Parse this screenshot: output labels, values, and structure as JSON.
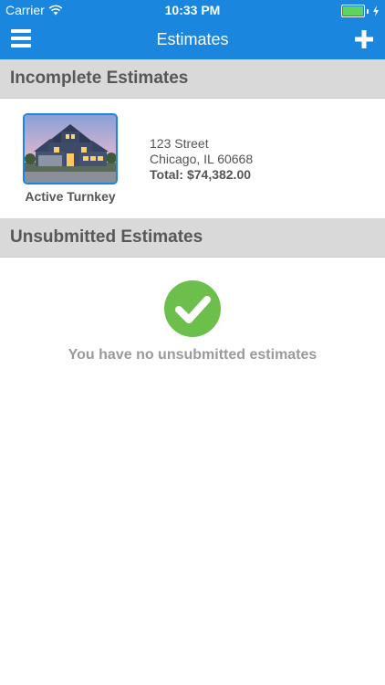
{
  "status_bar": {
    "carrier": "Carrier",
    "time": "10:33 PM"
  },
  "nav": {
    "title": "Estimates",
    "menu_icon": "hamburger-menu-icon",
    "add_icon": "plus-icon"
  },
  "sections": {
    "incomplete": {
      "title": "Incomplete Estimates",
      "items": [
        {
          "name": "Active Turnkey",
          "street": "123 Street",
          "city": "Chicago, IL 60668",
          "total": "Total: $74,382.00"
        }
      ]
    },
    "unsubmitted": {
      "title": "Unsubmitted Estimates",
      "empty_message": "You have no unsubmitted estimates",
      "empty_icon": "checkmark-circle-icon"
    }
  },
  "colors": {
    "primary": "#1b86de",
    "section_bg": "#d9d9d9",
    "success": "#6dbf4c",
    "battery": "#5fd35f"
  }
}
